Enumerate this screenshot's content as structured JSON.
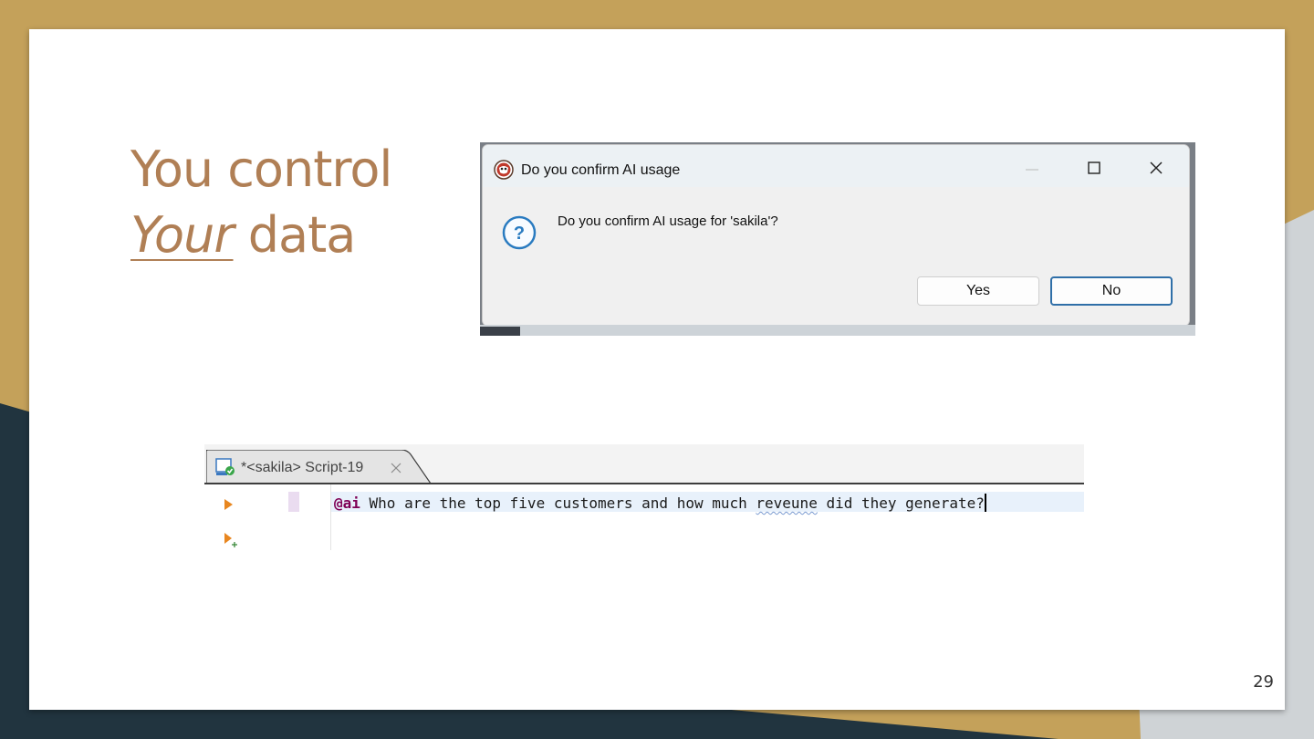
{
  "slide": {
    "title_line1": "You control",
    "title_emphasis": "Your",
    "title_line2_rest": " data",
    "page_number": "29"
  },
  "dialog": {
    "title": "Do you confirm AI usage",
    "message": "Do you confirm AI usage for 'sakila'?",
    "buttons": {
      "yes": "Yes",
      "no": "No"
    },
    "window_controls": [
      "minimize-icon",
      "maximize-icon",
      "close-icon"
    ]
  },
  "editor": {
    "tab_label": "*<sakila> Script-19",
    "code_keyword": "@ai",
    "code_before_typo": " Who are the top five customers and how much ",
    "code_typo": "reveune",
    "code_after_typo": " did they generate?"
  },
  "colors": {
    "frame_gold": "#c4a15a",
    "frame_dark": "#21343f",
    "title_brown": "#b07f55",
    "button_focus_blue": "#2f6fa8",
    "code_keyword": "#7f0055"
  }
}
